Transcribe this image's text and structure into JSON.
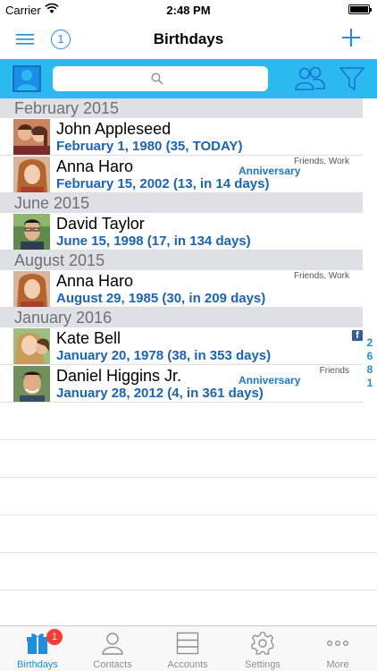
{
  "status_bar": {
    "carrier": "Carrier",
    "time": "2:48 PM"
  },
  "nav": {
    "title": "Birthdays",
    "count": "1"
  },
  "search": {
    "placeholder": "",
    "value": ""
  },
  "colors": {
    "accent": "#1d8de8",
    "toolbar": "#2bbaf0",
    "date_text": "#1964b8",
    "badge": "#ff3b30"
  },
  "sections": [
    {
      "title": "February 2015",
      "rows": [
        {
          "name": "John Appleseed",
          "date": "February 1, 1980 (35, TODAY)",
          "groups": "",
          "event": ""
        },
        {
          "name": "Anna Haro",
          "date": "February 15, 2002 (13, in 14 days)",
          "groups": "Friends, Work",
          "event": "Anniversary"
        }
      ]
    },
    {
      "title": "June 2015",
      "rows": [
        {
          "name": "David Taylor",
          "date": "June 15, 1998 (17, in 134 days)",
          "groups": "",
          "event": ""
        }
      ]
    },
    {
      "title": "August 2015",
      "rows": [
        {
          "name": "Anna Haro",
          "date": "August 29, 1985 (30, in 209 days)",
          "groups": "Friends, Work",
          "event": ""
        }
      ]
    },
    {
      "title": "January 2016",
      "rows": [
        {
          "name": "Kate Bell",
          "date": "January 20, 1978 (38, in 353 days)",
          "groups": "",
          "event": "",
          "facebook_icon": "f"
        },
        {
          "name": "Daniel Higgins Jr.",
          "date": "January 28, 2012 (4, in 361 days)",
          "groups": "Friends",
          "event": "Anniversary"
        }
      ]
    }
  ],
  "section_index": [
    "2",
    "6",
    "8",
    "1"
  ],
  "tabs": [
    {
      "label": "Birthdays",
      "icon": "gift-icon",
      "badge": "1",
      "active": true
    },
    {
      "label": "Contacts",
      "icon": "person-icon"
    },
    {
      "label": "Accounts",
      "icon": "accounts-icon"
    },
    {
      "label": "Settings",
      "icon": "gear-icon"
    },
    {
      "label": "More",
      "icon": "more-icon"
    }
  ]
}
